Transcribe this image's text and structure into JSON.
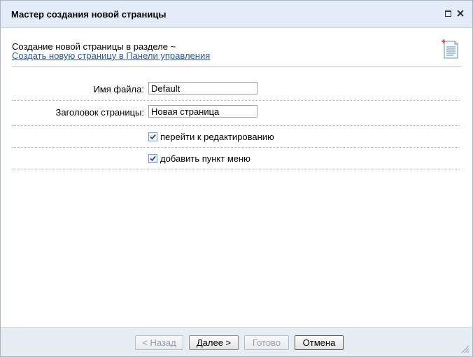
{
  "window": {
    "title": "Мастер создания новой страницы",
    "maximize_icon": "maximize-icon",
    "close_icon": "close-icon"
  },
  "header": {
    "section_text": "Создание новой страницы в разделе ~",
    "panel_link": "Создать новую страницу в Панели управления",
    "icon": "new-page-icon"
  },
  "form": {
    "filename": {
      "label": "Имя файла:",
      "value": "Default"
    },
    "page_title": {
      "label": "Заголовок страницы:",
      "value": "Новая страница"
    },
    "go_to_edit": {
      "label": "перейти к редактированию",
      "checked": true
    },
    "add_menu_item": {
      "label": "добавить пункт меню",
      "checked": true
    }
  },
  "footer": {
    "back_label": "< Назад",
    "next_label": "Далее >",
    "finish_label": "Готово",
    "cancel_label": "Отмена"
  },
  "colors": {
    "titlebar": "#e4edf7",
    "link": "#2a59b2",
    "footer": "#e6edf3"
  }
}
